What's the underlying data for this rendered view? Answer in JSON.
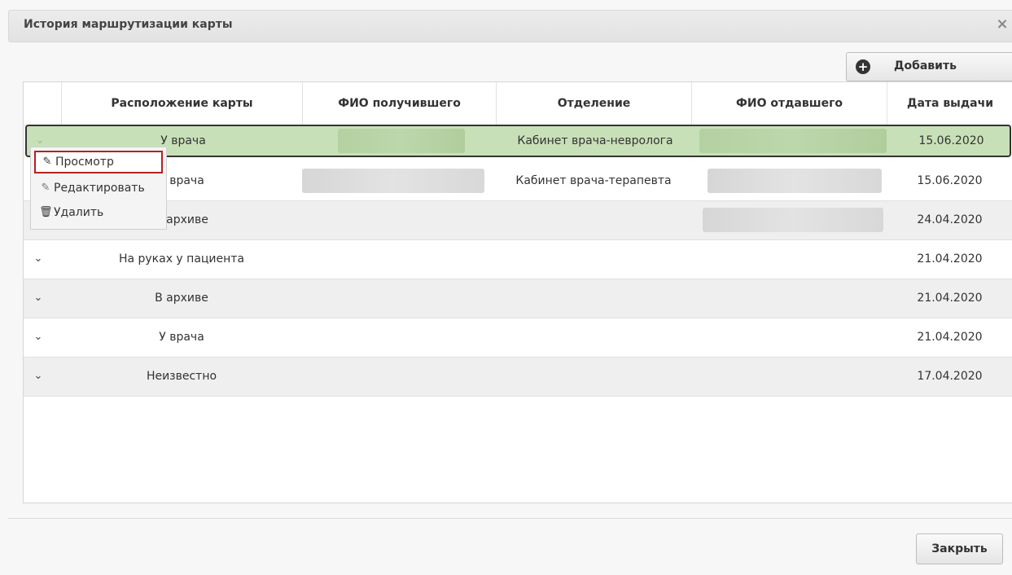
{
  "dialog": {
    "title": "История маршрутизации карты",
    "close_icon": "×"
  },
  "toolbar": {
    "add_label": "Добавить",
    "add_icon": "+"
  },
  "table": {
    "columns": [
      "Расположение карты",
      "ФИО получившего",
      "Отделение",
      "ФИО отдавшего",
      "Дата выдачи"
    ],
    "rows": [
      {
        "location": "У врача",
        "department": "Кабинет врача-невролога",
        "date": "15.06.2020"
      },
      {
        "location": "У врача",
        "department": "Кабинет врача-терапевта",
        "date": "15.06.2020"
      },
      {
        "location": "В архиве",
        "department": "",
        "date": "24.04.2020"
      },
      {
        "location": "На руках у пациента",
        "department": "",
        "date": "21.04.2020"
      },
      {
        "location": "В архиве",
        "department": "",
        "date": "21.04.2020"
      },
      {
        "location": "У врача",
        "department": "",
        "date": "21.04.2020"
      },
      {
        "location": "Неизвестно",
        "department": "",
        "date": "17.04.2020"
      }
    ]
  },
  "context_menu": {
    "items": [
      {
        "label": "Просмотр",
        "icon": "pencil-icon"
      },
      {
        "label": "Редактировать",
        "icon": "pencil-icon"
      },
      {
        "label": "Удалить",
        "icon": "trash-icon"
      }
    ]
  },
  "footer": {
    "close_label": "Закрыть"
  },
  "colors": {
    "selected_row": "#c8e0b8",
    "highlight_border": "#b22222"
  }
}
